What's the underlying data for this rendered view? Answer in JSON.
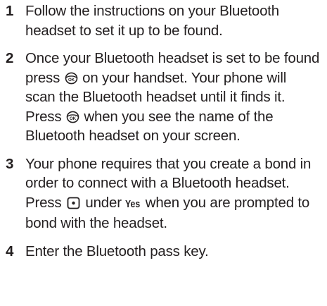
{
  "steps": [
    {
      "number": "1",
      "text": "Follow the instructions on your Bluetooth headset to set it up to be found."
    },
    {
      "number": "2",
      "part1": "Once your Bluetooth headset is set to be found press",
      "part2": "on your handset. Your phone will scan the Bluetooth headset until it finds it. Press",
      "part3": "when you see the name of the Bluetooth headset on your screen.",
      "icon": "ok-key-icon"
    },
    {
      "number": "3",
      "part1": "Your phone requires that you create a bond in order to connect with a Bluetooth headset. Press",
      "part2": "under",
      "softkey": "Yes",
      "part3": "when you are prompted to bond with the headset.",
      "icon": "center-select-key-icon"
    },
    {
      "number": "4",
      "text": "Enter the Bluetooth pass key."
    }
  ],
  "colors": {
    "text": "#231f20",
    "background": "#ffffff"
  }
}
